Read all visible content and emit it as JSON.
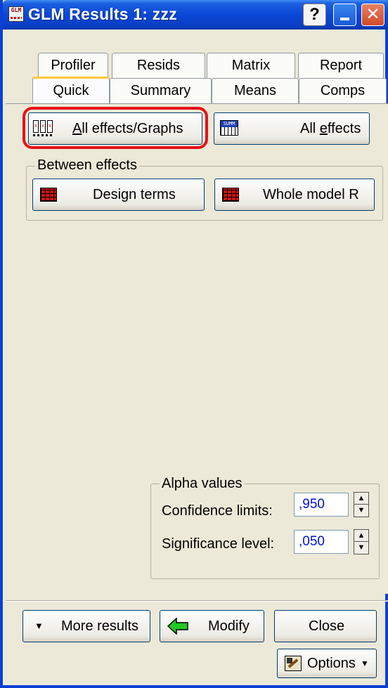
{
  "window": {
    "title": "GLM Results 1: zzz",
    "icon_text": "GLM"
  },
  "tabs_row1": [
    "Profiler",
    "Resids",
    "Matrix",
    "Report"
  ],
  "tabs_row2": [
    "Quick",
    "Summary",
    "Means",
    "Comps"
  ],
  "active_tab": "Quick",
  "buttons": {
    "all_effects_graphs": {
      "pre": "",
      "accel": "A",
      "post": "ll effects/Graphs"
    },
    "all_effects": {
      "pre": "All ",
      "accel": "e",
      "post": "ffects"
    },
    "sum_icon_text": "SUMM"
  },
  "between_effects": {
    "label": "Between effects",
    "design_terms": "Design terms",
    "whole_model": "Whole model R"
  },
  "alpha": {
    "label": "Alpha values",
    "confidence_label": "Confidence limits:",
    "confidence_value": ",950",
    "significance_label": "Significance level:",
    "significance_value": ",050"
  },
  "footer": {
    "more_results": "More results",
    "modify": "Modify",
    "close": "Close",
    "options": "Options"
  },
  "colors": {
    "highlight": "#e8101a",
    "titlebar": "#0a47d6",
    "value_text": "#0010d8"
  }
}
